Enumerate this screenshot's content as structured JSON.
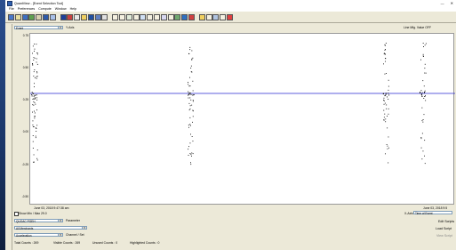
{
  "window": {
    "title": "QuantView - [Event Selection Tool]",
    "menu": [
      "File",
      "Preferences",
      "Compute",
      "Window",
      "Help"
    ],
    "controls": [
      "minimize",
      "close"
    ]
  },
  "toolbar": {
    "groups": [
      {
        "icons": [
          "select-icon",
          "table-icon",
          "chart-icon",
          "grid-icon",
          "export-icon",
          "axis-icon",
          "filter-icon"
        ]
      },
      {
        "icons": [
          "blue-block-icon",
          "bars-icon",
          "sort-icon",
          "scale-icon",
          "palette-icon",
          "zoom-icon",
          "pan-icon"
        ]
      },
      {
        "icons": [
          "compare-icon",
          "list-icon",
          "split-icon",
          "merge-icon",
          "range-icon",
          "measure-icon",
          "cursor-icon",
          "align-icon",
          "stack-icon",
          "flag-icon",
          "tree-icon",
          "link-icon"
        ]
      },
      {
        "icons": [
          "folder-icon",
          "note-icon",
          "camera-icon",
          "stats-icon",
          "highlight-icon"
        ]
      }
    ]
  },
  "controls": {
    "top_select": "Event",
    "y_axis_label": "Y-Axis",
    "right_info": "Line Mfg. Value OFF",
    "ylim": [
      -0.75,
      0.75
    ],
    "y_ticks": [
      "0.75",
      "0.50",
      "0.25",
      "0.00",
      "-0.25",
      "-0.50",
      "-0.75"
    ],
    "x_start": "June 03, 2018 9:47:38 am",
    "x_end": "June 03, 2018 9:5",
    "show_min_max_label": "Show Min / Max",
    "show_min_max_value": "29.0",
    "parameter_label": "Parameter",
    "parameter_value": "QUOAC PGEH",
    "subparam_value": "All Merchants",
    "channel_label": "Channel / Set",
    "channel_value": "Acceleration",
    "x_axis_label": "X-Axis",
    "x_axis_value": "Time of Event",
    "edit_button": "Edit Scripts",
    "load_button": "Load Script",
    "view_button": "View Script",
    "status": {
      "total": "Total Counts : 269",
      "visible": "Visible Counts : 269",
      "unused": "Unused Counts : 0",
      "highlighted": "Highlighted Counts : 0"
    }
  },
  "colors": {
    "titlebar": "#ffffff",
    "panel": "#ece9d8",
    "baseline": "#2a2ad0",
    "dots": "#000000"
  }
}
